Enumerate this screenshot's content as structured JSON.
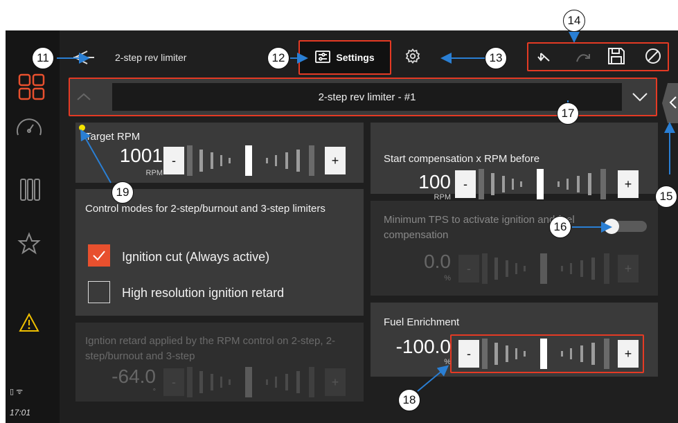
{
  "header": {
    "page_title": "2-step rev limiter",
    "settings_tab_label": "Settings"
  },
  "toolbar": {
    "undo_icon": "undo-icon",
    "redo_icon": "redo-icon",
    "save_icon": "save-icon",
    "cancel_icon": "cancel-icon"
  },
  "selector": {
    "current": "2-step rev limiter - #1"
  },
  "sidebar": {
    "time": "17:01",
    "items": [
      "dashboard-grid-icon",
      "gauge-icon",
      "columns-icon",
      "star-icon",
      "warning-icon"
    ]
  },
  "panels": {
    "target_rpm": {
      "title": "Target RPM",
      "value": "1001",
      "unit": "RPM",
      "minus": "-",
      "plus": "+"
    },
    "start_comp": {
      "title": "Start compensation x RPM before",
      "value": "100",
      "unit": "RPM",
      "minus": "-",
      "plus": "+"
    },
    "control_modes": {
      "title": "Control modes for 2-step/burnout and 3-step limiters",
      "options": [
        {
          "label": "Ignition cut (Always active)",
          "checked": true
        },
        {
          "label": "High resolution ignition retard",
          "checked": false
        }
      ]
    },
    "min_tps": {
      "title": "Minimum TPS to activate ignition and fuel compensation",
      "value": "0.0",
      "unit": "%",
      "minus": "-",
      "plus": "+",
      "toggle_on": false
    },
    "ign_retard": {
      "title": "Igntion retard applied by the RPM control on 2-step, 2-step/burnout and 3-step",
      "value": "-64.0",
      "unit": "°",
      "minus": "-",
      "plus": "+"
    },
    "fuel_enrich": {
      "title": "Fuel Enrichment",
      "value": "-100.0",
      "unit": "%",
      "minus": "-",
      "plus": "+"
    }
  },
  "callouts": [
    "11",
    "12",
    "13",
    "14",
    "15",
    "16",
    "17",
    "18",
    "19"
  ],
  "colors": {
    "accent": "#e8502e",
    "highlight_box": "#e53a24",
    "marker": "#f5e400"
  }
}
